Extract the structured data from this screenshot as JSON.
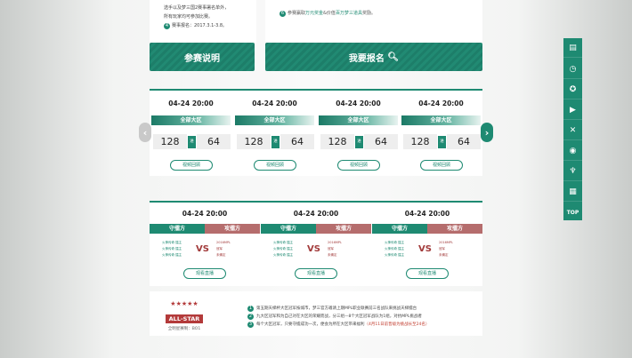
{
  "top_left": {
    "line1": "选手以及梦三国2赛事署名单外，",
    "line2": "所有玩家均可参加比赛。",
    "reg_num": "4",
    "reg_text": "赛事报名：2017.3.1-3.8。"
  },
  "top_right": {
    "num": "6",
    "text_a": "参赛赢取",
    "text_b": "万元奖金",
    "text_c": "&价值",
    "text_d": "百万梦三道具",
    "text_e": "奖励。"
  },
  "buttons": {
    "rules_label": "参赛说明",
    "signup_label": "我要报名",
    "signup_icon": "search-icon"
  },
  "schedule": {
    "cards": [
      {
        "time": "04-24 20:00",
        "zone": "全部大区",
        "left": "128",
        "mid": "进",
        "right": "64",
        "replay": "视频回顾"
      },
      {
        "time": "04-24 20:00",
        "zone": "全部大区",
        "left": "128",
        "mid": "进",
        "right": "64",
        "replay": "视频回顾"
      },
      {
        "time": "04-24 20:00",
        "zone": "全部大区",
        "left": "128",
        "mid": "进",
        "right": "64",
        "replay": "视频回顾"
      },
      {
        "time": "04-24 20:00",
        "zone": "全部大区",
        "left": "128",
        "mid": "进",
        "right": "64",
        "replay": "视频回顾"
      }
    ],
    "left_arrow": "‹",
    "right_arrow": "›"
  },
  "live": {
    "cards": [
      {
        "time": "04-24 20:00",
        "defense": "守擂方",
        "attack": "攻擂方",
        "d1": "火神传奇 擂主",
        "d2": "火神传奇 擂主",
        "d3": "火神传奇 擂主",
        "vs": "VS",
        "a1": "2016MPL",
        "a2": "冠军",
        "a3": "未确定",
        "watch": "观看直播"
      },
      {
        "time": "04-24 20:00",
        "defense": "守擂方",
        "attack": "攻擂方",
        "d1": "火神传奇 擂主",
        "d2": "火神传奇 擂主",
        "d3": "火神传奇 擂主",
        "vs": "VS",
        "a1": "2016MPL",
        "a2": "冠军",
        "a3": "未确定",
        "watch": "观看直播"
      },
      {
        "time": "04-24 20:00",
        "defense": "守擂方",
        "attack": "攻擂方",
        "d1": "火神传奇 擂主",
        "d2": "火神传奇 擂主",
        "d3": "火神传奇 擂主",
        "vs": "VS",
        "a1": "2016MPL",
        "a2": "冠军",
        "a3": "未确定",
        "watch": "观看直播"
      }
    ]
  },
  "bottom": {
    "stars": "★★★★★",
    "allstar": "ALL-STAR",
    "sub": "全明星赛制：BO1",
    "rule1": "第五期天梯杯大区冠军按城市，梦三官方邀请上期MPL职业联赛前三名战队来挑战天梯擂台",
    "rule2": "九大区冠军和为自己对在大区的荣耀而战，分三组—8个大区冠军战队为1组，对抗MPL挑战者",
    "rule3": "每个大区冠军，只要守擂成功一次，便会为所在大区带来福利",
    "rule3_red": "（4月11日前晋级为挑战长至24名）"
  },
  "side": {
    "icons": [
      "document-icon",
      "clock-icon",
      "star-icon",
      "video-icon",
      "sword-icon",
      "play-icon",
      "trophy-icon",
      "calendar-icon"
    ],
    "glyphs": [
      "▤",
      "◷",
      "✪",
      "▶",
      "✕",
      "◉",
      "♆",
      "▦"
    ],
    "top_label": "TOP"
  },
  "colors": {
    "accent": "#1e8a72",
    "attack": "#b56d6d",
    "red": "#a23b3b"
  }
}
